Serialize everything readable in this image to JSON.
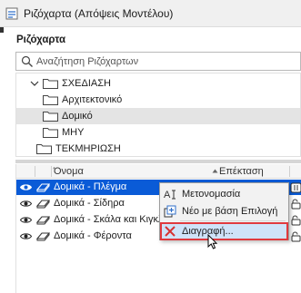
{
  "window": {
    "title": "Ριζόχαρτα (Απόψεις Μοντέλου)",
    "title_icon": "layers-icon"
  },
  "section_title": "Ριζόχαρτα",
  "search": {
    "placeholder": "Αναζήτηση Ριζόχαρτων",
    "value": ""
  },
  "tree": {
    "items": [
      {
        "label": "ΣΧΕΔΙΑΣΗ",
        "expanded": true,
        "level": 0
      },
      {
        "label": "Αρχιτεκτονικό",
        "level": 1
      },
      {
        "label": "Δομικό",
        "level": 1,
        "selected": true
      },
      {
        "label": "ΜΗΥ",
        "level": 1
      },
      {
        "label": "ΤΕΚΜΗΡΙΩΣΗ",
        "level": 0
      }
    ]
  },
  "grid": {
    "columns": {
      "name": "Όνομα",
      "extension": "Επέκταση"
    },
    "rows": [
      {
        "name": "Δομικά - Πλέγμα",
        "selected": true
      },
      {
        "name": "Δομικά - Σίδηρα"
      },
      {
        "name": "Δομικά - Σκάλα και Κιγκλίδωμα"
      },
      {
        "name": "Δομικά - Φέροντα"
      }
    ]
  },
  "context_menu": {
    "items": [
      {
        "label": "Μετονομασία",
        "icon": "rename-icon"
      },
      {
        "label": "Νέο με βάση Επιλογή",
        "icon": "new-from-selection-icon"
      },
      {
        "label": "Διαγραφή...",
        "icon": "delete-icon",
        "highlighted": true
      }
    ]
  },
  "colors": {
    "selection": "#0a5bd7",
    "menu_highlight": "#cfe3f9",
    "focus_outline": "#e0393e",
    "delete_icon": "#d63131"
  }
}
